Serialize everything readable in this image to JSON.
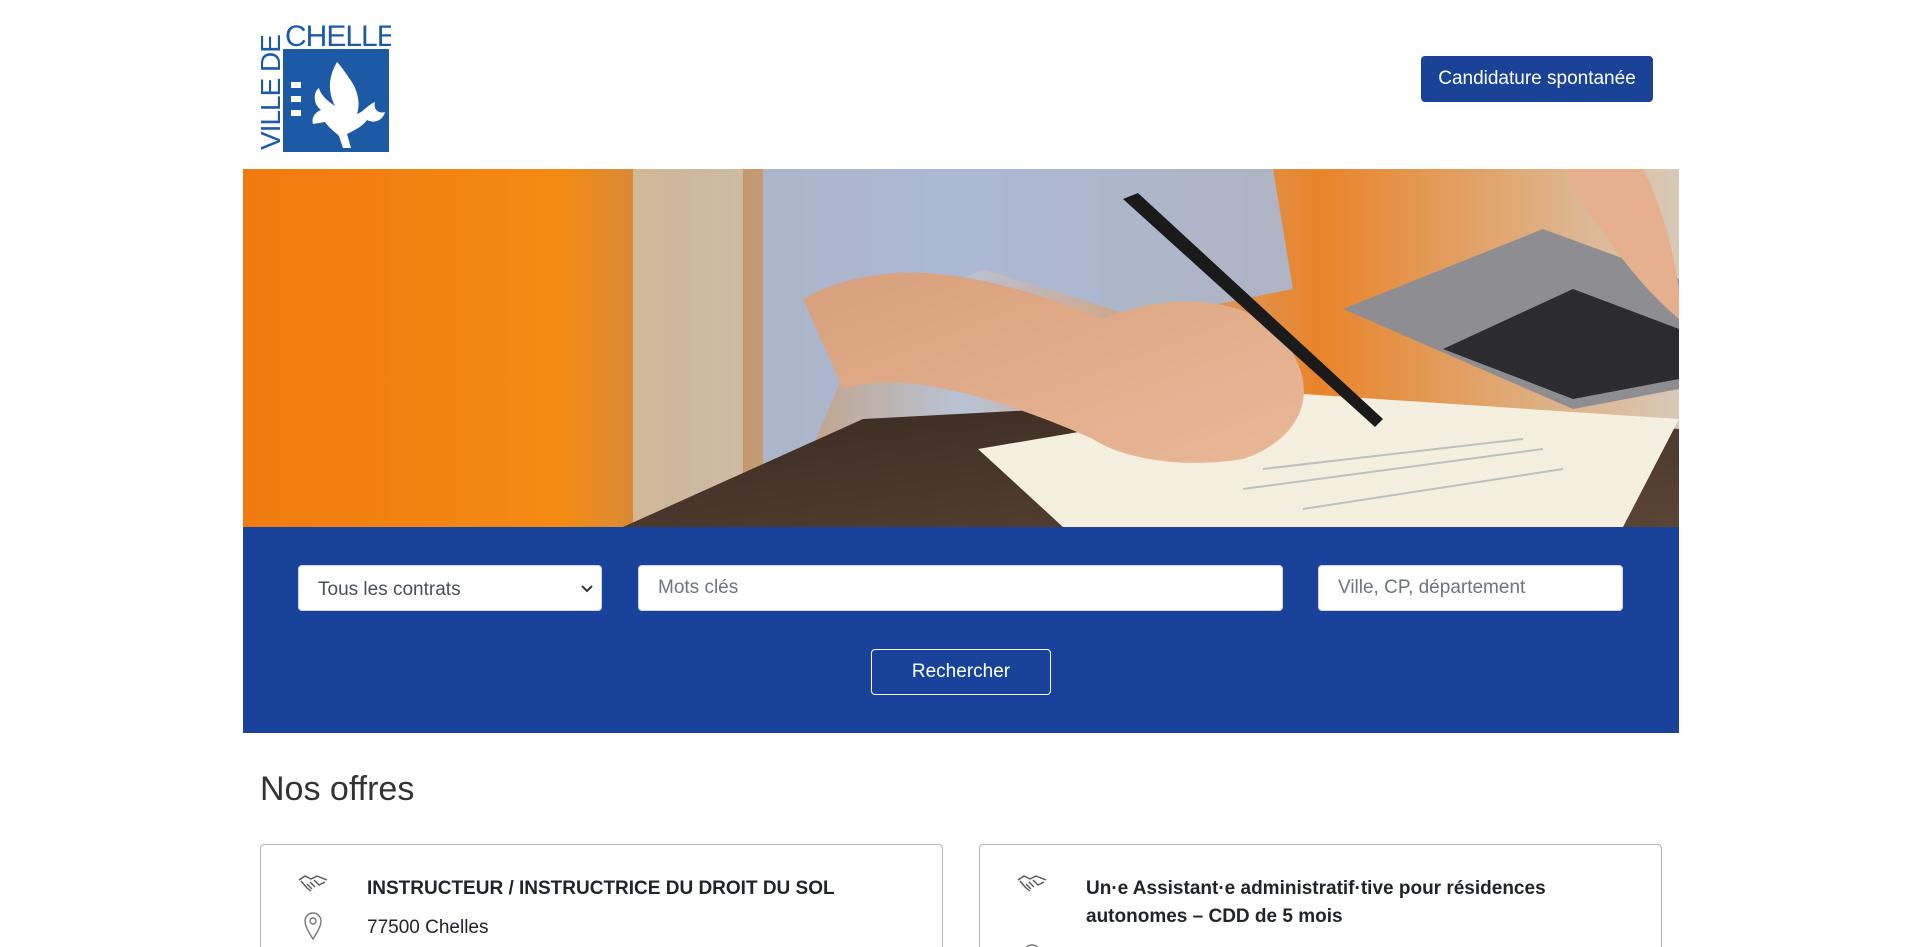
{
  "header": {
    "logo_text": "VILLE DE CHELLES",
    "logo_top": "CHELLES",
    "logo_side": "VILLE DE",
    "spontaneous_label": "Candidature spontanée"
  },
  "search": {
    "contract_selected": "Tous les contrats",
    "keywords_placeholder": "Mots clés",
    "location_placeholder": "Ville, CP, département",
    "submit_label": "Rechercher"
  },
  "offers": {
    "heading": "Nos offres",
    "items": [
      {
        "title": "INSTRUCTEUR / INSTRUCTRICE DU DROIT DU SOL",
        "location": "77500 Chelles"
      },
      {
        "title": "Un·e Assistant·e administratif·tive pour résidences autonomes – CDD de 5 mois",
        "location": ""
      }
    ]
  },
  "colors": {
    "brand_blue": "#1a4296",
    "band_blue": "#19439a",
    "logo_blue": "#1c5aa6"
  },
  "icons": [
    "logo-icon",
    "chevron-down-icon",
    "handshake-icon",
    "map-pin-icon"
  ]
}
